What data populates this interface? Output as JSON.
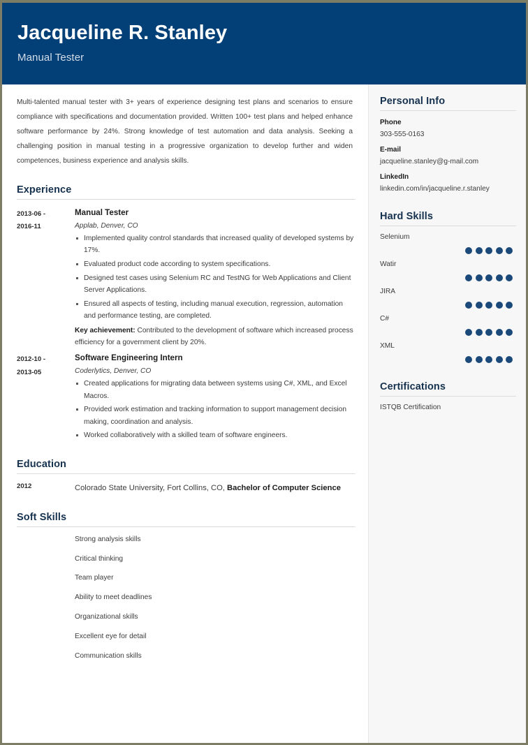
{
  "colors": {
    "header_bg": "#044078",
    "heading": "#16324f",
    "sidebar_bg": "#f7f7f7",
    "page_border": "#7d7d66",
    "dot_filled": "#1b4a7a"
  },
  "header": {
    "name": "Jacqueline R. Stanley",
    "job_title": "Manual Tester"
  },
  "summary": "Multi-talented manual tester with 3+ years of experience designing test plans and scenarios to ensure compliance with specifications and documentation provided. Written 100+ test plans and helped enhance software performance by 24%. Strong knowledge of test automation and data analysis. Seeking a challenging position in manual testing in a progressive organization to develop further and widen competences, business experience and analysis skills.",
  "sections": {
    "experience_heading": "Experience",
    "education_heading": "Education",
    "soft_skills_heading": "Soft Skills"
  },
  "experience": [
    {
      "date_from": "2013-06 -",
      "date_to": "2016-11",
      "job_title": "Manual Tester",
      "company": "Applab, Denver, CO",
      "bullets": [
        "Implemented quality control standards that increased quality of developed systems by 17%.",
        "Evaluated product code according to system specifications.",
        "Designed test cases using Selenium RC and TestNG for Web Applications and Client Server Applications.",
        "Ensured all aspects of testing, including manual execution, regression, automation and performance testing, are completed."
      ],
      "key_achievement_label": "Key achievement:",
      "key_achievement_text": " Contributed to the development of software which increased process efficiency for a government client by 20%."
    },
    {
      "date_from": "2012-10 -",
      "date_to": "2013-05",
      "job_title": "Software Engineering Intern",
      "company": "Coderlytics, Denver, CO",
      "bullets": [
        "Created applications for migrating data between systems using C#, XML, and Excel Macros.",
        "Provided work estimation and tracking information to support management decision making, coordination and analysis.",
        "Worked collaboratively with a skilled team of software engineers."
      ],
      "key_achievement_label": "",
      "key_achievement_text": ""
    }
  ],
  "education": [
    {
      "year": "2012",
      "school_text": "Colorado State University, Fort Collins, CO, ",
      "degree": "Bachelor of Computer Science"
    }
  ],
  "soft_skills": [
    "Strong analysis skills",
    "Critical thinking",
    "Team player",
    "Ability to meet deadlines",
    "Organizational skills",
    "Excellent eye for detail",
    "Communication skills"
  ],
  "sidebar": {
    "personal_info_heading": "Personal Info",
    "personal_info": [
      {
        "label": "Phone",
        "value": "303-555-0163"
      },
      {
        "label": "E-mail",
        "value": "jacqueline.stanley@g-mail.com"
      },
      {
        "label": "LinkedIn",
        "value": "linkedin.com/in/jacqueline.r.stanley"
      }
    ],
    "hard_skills_heading": "Hard Skills",
    "hard_skills": [
      {
        "name": "Selenium",
        "rating": 5,
        "max": 5
      },
      {
        "name": "Watir",
        "rating": 5,
        "max": 5
      },
      {
        "name": "JIRA",
        "rating": 5,
        "max": 5
      },
      {
        "name": "C#",
        "rating": 5,
        "max": 5
      },
      {
        "name": "XML",
        "rating": 5,
        "max": 5
      }
    ],
    "certifications_heading": "Certifications",
    "certifications": [
      "ISTQB Certification"
    ]
  }
}
